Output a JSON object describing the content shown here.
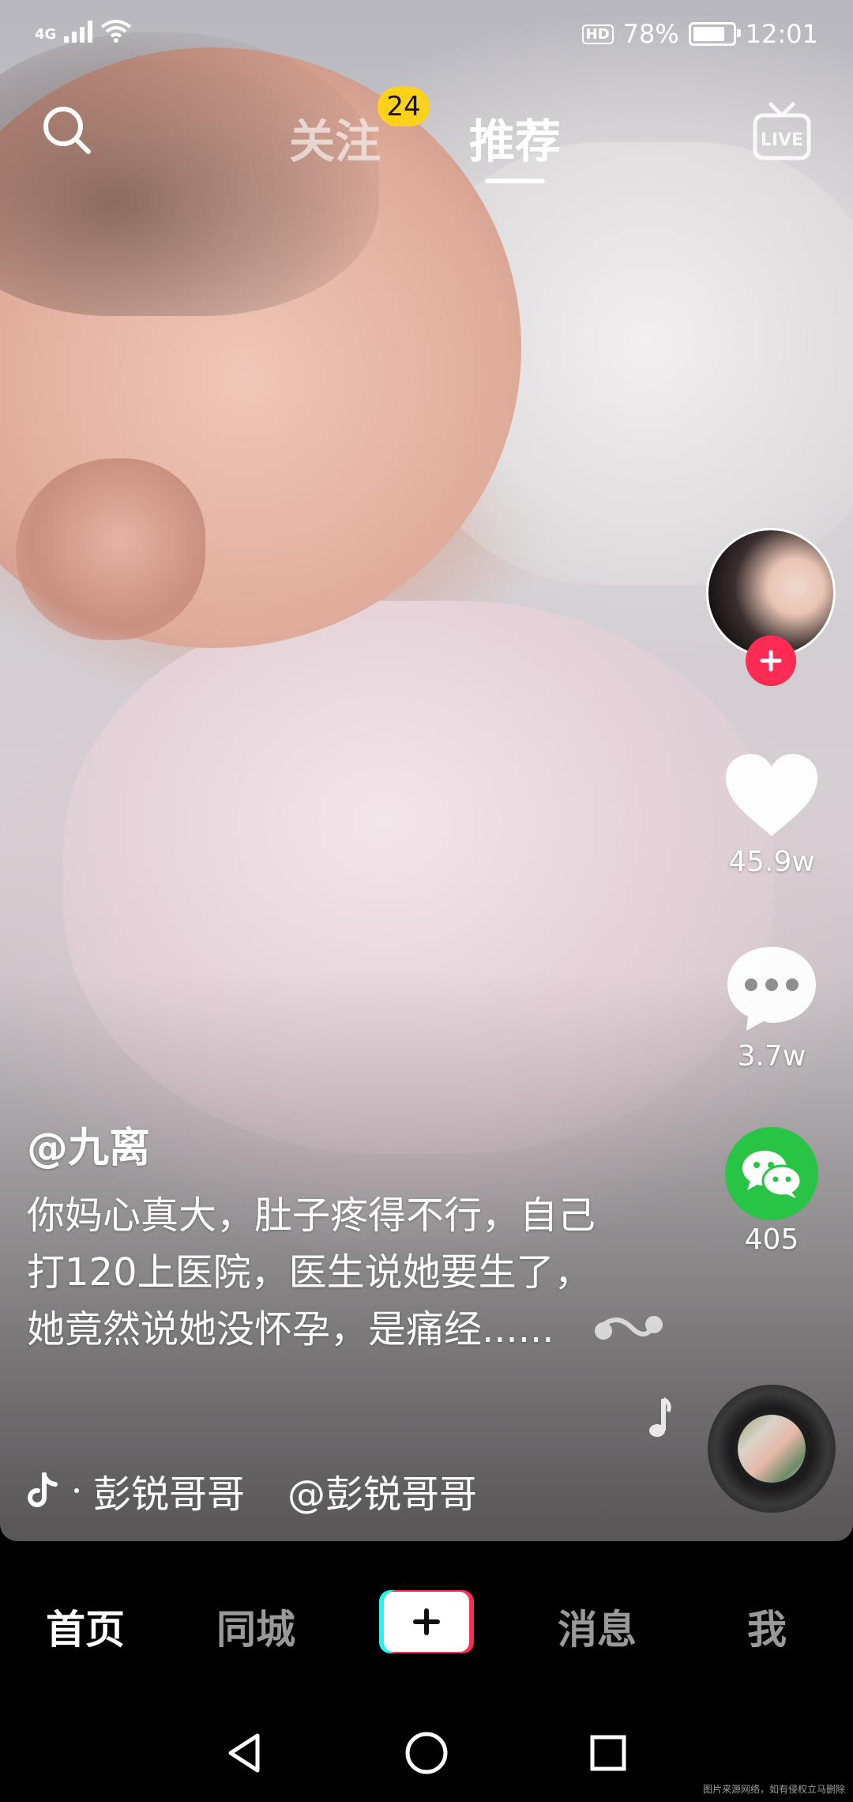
{
  "status_bar": {
    "network": "4G",
    "hd_label": "HD",
    "battery": "78%",
    "time": "12:01"
  },
  "top_nav": {
    "follow_label": "关注",
    "follow_badge": "24",
    "recommend_label": "推荐",
    "live_label": "LIVE",
    "search_icon": "search-icon"
  },
  "video": {
    "username": "@九离",
    "caption": "你妈心真大，肚子疼得不行，自己打120上医院，医生说她要生了，她竟然说她没怀孕，是痛经......",
    "music_title": "彭锐哥哥",
    "music_author": "@彭锐哥哥"
  },
  "actions": {
    "likes": "45.9w",
    "comments": "3.7w",
    "shares": "405"
  },
  "bottom_nav": {
    "home": "首页",
    "nearby": "同城",
    "messages": "消息",
    "me": "我"
  },
  "watermark": "图片来源网络，如有侵权立马删除",
  "colors": {
    "badge": "#fed21b",
    "follow_plus": "#fe2c55",
    "wechat": "#28c445",
    "tiktok_cyan": "#25f4ee",
    "tiktok_red": "#fe2c55"
  }
}
